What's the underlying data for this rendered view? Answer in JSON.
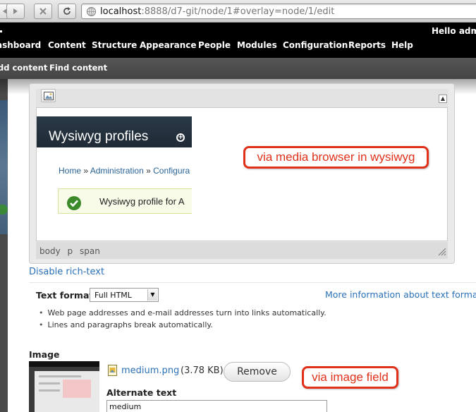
{
  "browser": {
    "url_host": "localhost",
    "url_rest": ":8888/d7-git/node/1#overlay=node/1/edit"
  },
  "toolbar": {
    "greeting": "Hello admir",
    "menu": [
      "ashboard",
      "Content",
      "Structure",
      "Appearance",
      "People",
      "Modules",
      "Configuration",
      "Reports",
      "Help"
    ],
    "shortcuts": [
      "dd content",
      "Find content"
    ]
  },
  "editor": {
    "path": [
      "body",
      "p",
      "span"
    ],
    "embedded": {
      "title": "Wysiwyg profiles",
      "breadcrumb_home": "Home",
      "breadcrumb_sep": "»",
      "breadcrumb_admin": "Administration",
      "breadcrumb_config": "Configura",
      "message": "Wysiwyg profile for A"
    }
  },
  "annotations": {
    "media_browser": "via media browser in wysiwyg",
    "image_field": "via image field"
  },
  "disable_rich_text": "Disable rich-text",
  "text_format": {
    "label": "Text format",
    "selected": "Full HTML",
    "more_info": "More information about text formats",
    "tips": [
      "Web page addresses and e-mail addresses turn into links automatically.",
      "Lines and paragraphs break automatically."
    ]
  },
  "image_field": {
    "label": "Image",
    "file_name": "medium.png",
    "file_size": "(3.78 KB)",
    "remove_label": "Remove",
    "alt_label": "Alternate text",
    "alt_value": "medium"
  },
  "colors": {
    "toolbar_bg": "#000000",
    "link": "#2a71b8",
    "callout": "#e0311a"
  }
}
